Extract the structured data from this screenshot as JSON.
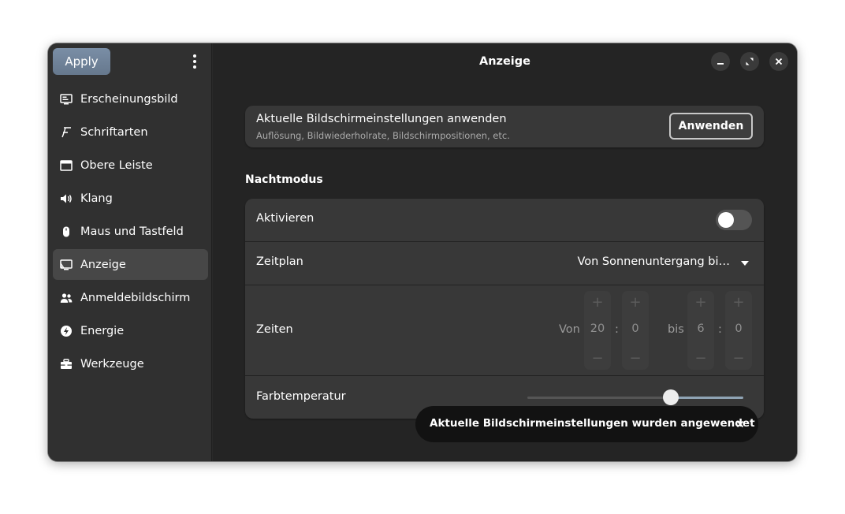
{
  "sidebar": {
    "apply_label": "Apply",
    "menu_icon": "kebab-menu-icon",
    "items": [
      {
        "label": "Erscheinungsbild",
        "icon": "appearance-icon"
      },
      {
        "label": "Schriftarten",
        "icon": "font-icon"
      },
      {
        "label": "Obere Leiste",
        "icon": "top-bar-icon"
      },
      {
        "label": "Klang",
        "icon": "speaker-icon"
      },
      {
        "label": "Maus und Tastfeld",
        "icon": "mouse-icon"
      },
      {
        "label": "Anzeige",
        "icon": "display-icon",
        "active": true
      },
      {
        "label": "Anmeldebildschirm",
        "icon": "users-icon"
      },
      {
        "label": "Energie",
        "icon": "power-icon"
      },
      {
        "label": "Werkzeuge",
        "icon": "toolbox-icon"
      }
    ]
  },
  "header": {
    "title": "Anzeige",
    "controls": [
      "minimize-icon",
      "maximize-icon",
      "close-icon"
    ]
  },
  "apply_card": {
    "title": "Aktuelle Bildschirmeinstellungen anwenden",
    "subtitle": "Auflösung, Bildwiederholrate, Bildschirmpositionen, etc.",
    "button_label": "Anwenden"
  },
  "nightmode": {
    "section_title": "Nachtmodus",
    "activate_label": "Aktivieren",
    "activate_on": false,
    "schedule_label": "Zeitplan",
    "schedule_value": "Von Sonnenuntergang bi…",
    "times_label": "Zeiten",
    "from_word": "Von",
    "from_hour": "20",
    "from_minute": "0",
    "to_word": "bis",
    "to_hour": "6",
    "to_minute": "0",
    "colon": ":",
    "plus": "+",
    "minus": "−",
    "temperature_label": "Farbtemperatur",
    "temperature_level": 0.66
  },
  "toast": {
    "message": "Aktuelle Bildschirmeinstellungen wurden angewendet"
  },
  "colors": {
    "accent": "#6f8399",
    "window_bg": "#242424",
    "sidebar_bg": "#303030",
    "card_bg": "#383838"
  }
}
